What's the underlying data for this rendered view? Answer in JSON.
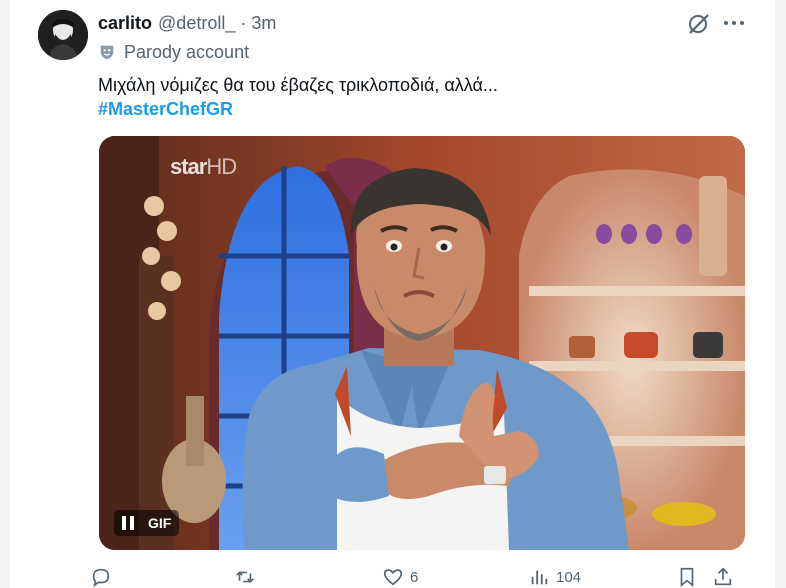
{
  "tweet": {
    "author_name": "carlito",
    "handle": "@detroll_",
    "separator": "·",
    "time": "3m",
    "parody_label": "Parody account",
    "text": "Μιχάλη νόμιζες θα του έβαζες τρικλοποδιά, αλλά...",
    "hashtag": "#MasterChefGR"
  },
  "media": {
    "watermark_main": "star",
    "watermark_hd": "HD",
    "gif_label": "GIF"
  },
  "actions": {
    "replies": "",
    "reposts": "",
    "likes": "6",
    "views": "104"
  },
  "icons": {
    "grok": "grok-icon",
    "more": "more-icon",
    "parody": "parody-mask-icon",
    "reply": "reply-icon",
    "repost": "repost-icon",
    "like": "heart-icon",
    "views": "views-icon",
    "bookmark": "bookmark-icon",
    "share": "share-icon"
  },
  "colors": {
    "link": "#1d9bf0",
    "secondary_text": "#536471",
    "primary_text": "#0f1419"
  }
}
